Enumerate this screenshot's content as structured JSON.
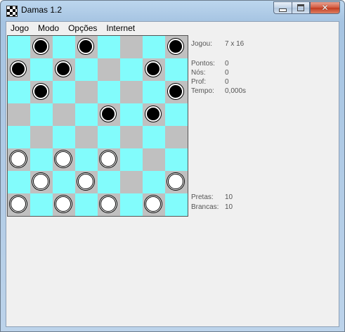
{
  "window": {
    "title": "Damas 1.2"
  },
  "menu": [
    "Jogo",
    "Modo",
    "Opções",
    "Internet"
  ],
  "board": {
    "size": 8,
    "colors": {
      "light": "#82fcfc",
      "dark": "#c0c0c0",
      "black_piece": "#000000",
      "white_piece": "#ffffff"
    },
    "pieces": [
      {
        "row": 0,
        "col": 1,
        "color": "black"
      },
      {
        "row": 0,
        "col": 3,
        "color": "black"
      },
      {
        "row": 0,
        "col": 7,
        "color": "black"
      },
      {
        "row": 1,
        "col": 0,
        "color": "black"
      },
      {
        "row": 1,
        "col": 2,
        "color": "black"
      },
      {
        "row": 1,
        "col": 6,
        "color": "black"
      },
      {
        "row": 2,
        "col": 1,
        "color": "black"
      },
      {
        "row": 2,
        "col": 7,
        "color": "black"
      },
      {
        "row": 3,
        "col": 4,
        "color": "black"
      },
      {
        "row": 3,
        "col": 6,
        "color": "black"
      },
      {
        "row": 5,
        "col": 0,
        "color": "white"
      },
      {
        "row": 5,
        "col": 2,
        "color": "white"
      },
      {
        "row": 5,
        "col": 4,
        "color": "white"
      },
      {
        "row": 6,
        "col": 1,
        "color": "white"
      },
      {
        "row": 6,
        "col": 3,
        "color": "white"
      },
      {
        "row": 6,
        "col": 7,
        "color": "white"
      },
      {
        "row": 7,
        "col": 0,
        "color": "white"
      },
      {
        "row": 7,
        "col": 2,
        "color": "white"
      },
      {
        "row": 7,
        "col": 4,
        "color": "white"
      },
      {
        "row": 7,
        "col": 6,
        "color": "white"
      }
    ]
  },
  "info": {
    "jogou": {
      "label": "Jogou:",
      "value": "7 x 16"
    },
    "pontos": {
      "label": "Pontos:",
      "value": "0"
    },
    "nos": {
      "label": "Nós:",
      "value": "0"
    },
    "prof": {
      "label": "Prof:",
      "value": "0"
    },
    "tempo": {
      "label": "Tempo:",
      "value": "0,000s"
    },
    "pretas": {
      "label": "Pretas:",
      "value": "10"
    },
    "brancas": {
      "label": "Brancas:",
      "value": "10"
    }
  }
}
